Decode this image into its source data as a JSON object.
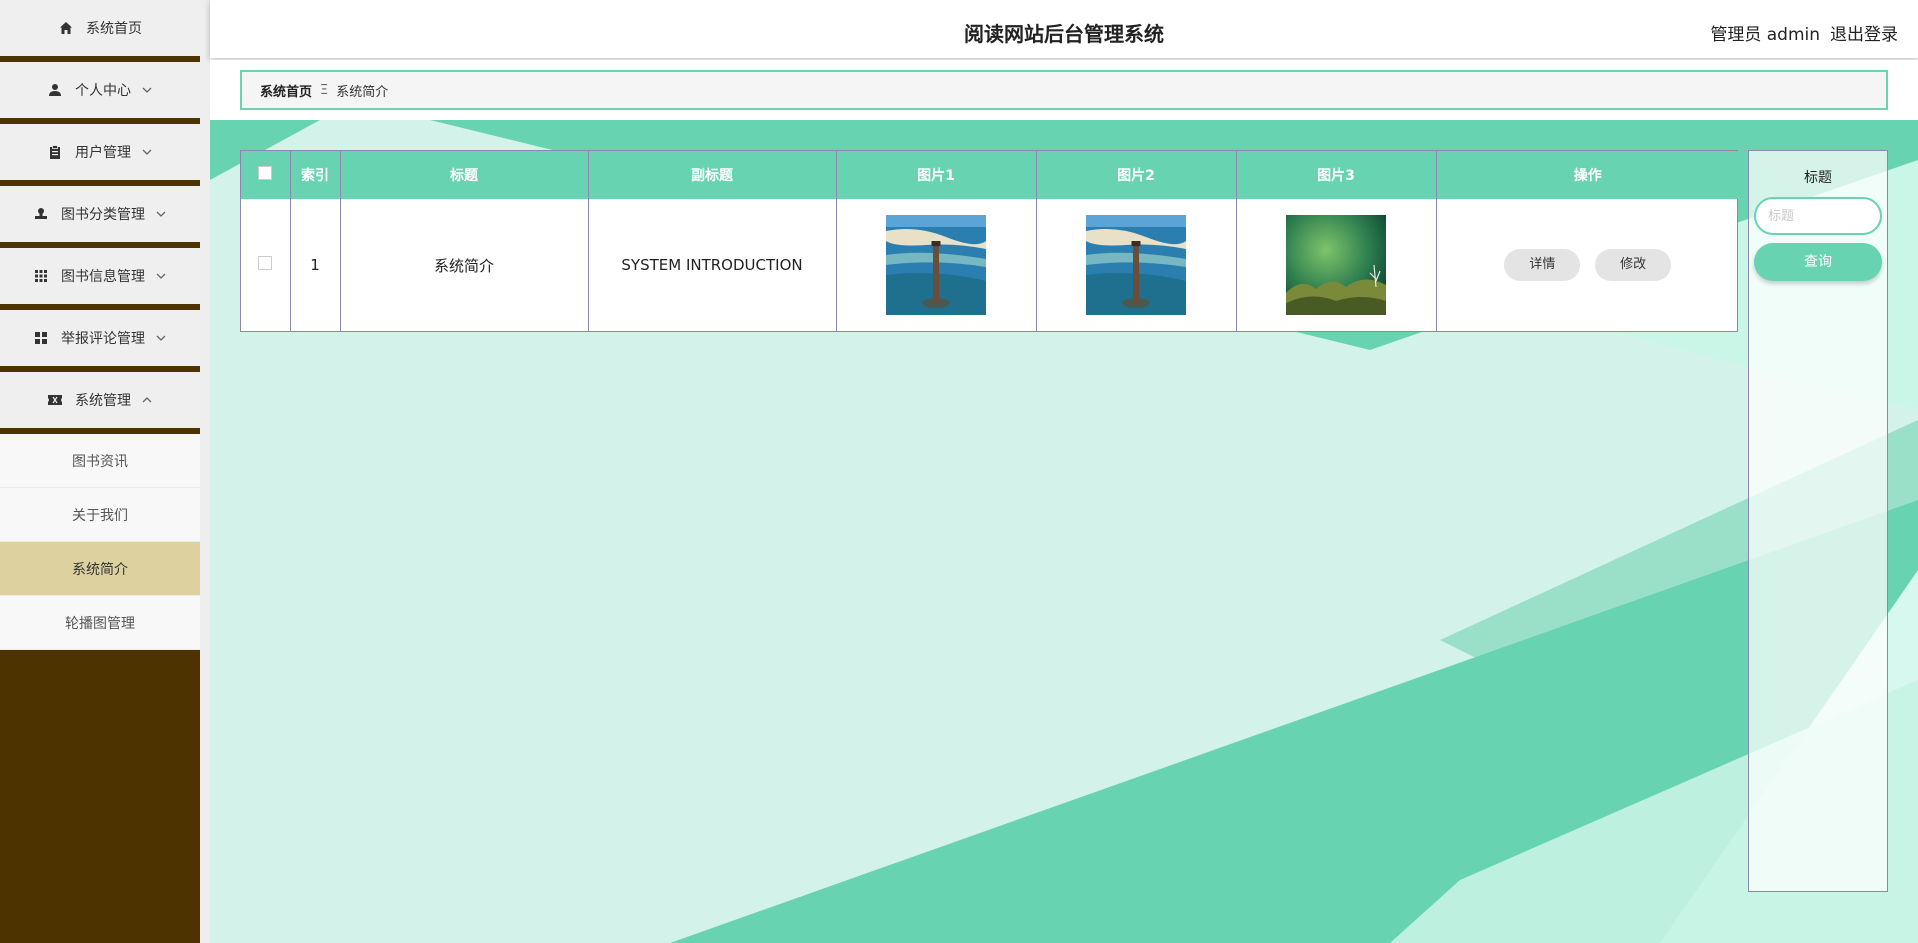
{
  "header": {
    "title": "阅读网站后台管理系统",
    "user_label": "管理员 admin",
    "logout_label": "退出登录"
  },
  "sidebar": {
    "items": [
      {
        "label": "系统首页",
        "icon": "home-icon",
        "chevron": false
      },
      {
        "label": "个人中心",
        "icon": "person-icon",
        "chevron": "down"
      },
      {
        "label": "用户管理",
        "icon": "clipboard-icon",
        "chevron": "down"
      },
      {
        "label": "图书分类管理",
        "icon": "stamp-icon",
        "chevron": "down"
      },
      {
        "label": "图书信息管理",
        "icon": "grid-icon",
        "chevron": "down"
      },
      {
        "label": "举报评论管理",
        "icon": "dashboard-icon",
        "chevron": "down"
      },
      {
        "label": "系统管理",
        "icon": "ticket-icon",
        "chevron": "up"
      }
    ],
    "subitems": [
      {
        "label": "图书资讯"
      },
      {
        "label": "关于我们"
      },
      {
        "label": "系统简介"
      },
      {
        "label": "轮播图管理"
      }
    ]
  },
  "breadcrumb": {
    "home": "系统首页",
    "separator": "Ξ",
    "current": "系统简介"
  },
  "table": {
    "columns": [
      "索引",
      "标题",
      "副标题",
      "图片1",
      "图片2",
      "图片3",
      "操作"
    ],
    "rows": [
      {
        "index": "1",
        "title": "系统简介",
        "subtitle": "SYSTEM INTRODUCTION",
        "images": [
          "lighthouse-photo",
          "lighthouse-photo",
          "moss-photo"
        ],
        "actions": [
          "详情",
          "修改"
        ]
      }
    ]
  },
  "search": {
    "label": "标题",
    "placeholder": "标题",
    "button": "查询"
  },
  "colors": {
    "accent": "#67d3b0",
    "sidebar_bg": "#4d3300",
    "active_sub": "#ddd29f"
  }
}
